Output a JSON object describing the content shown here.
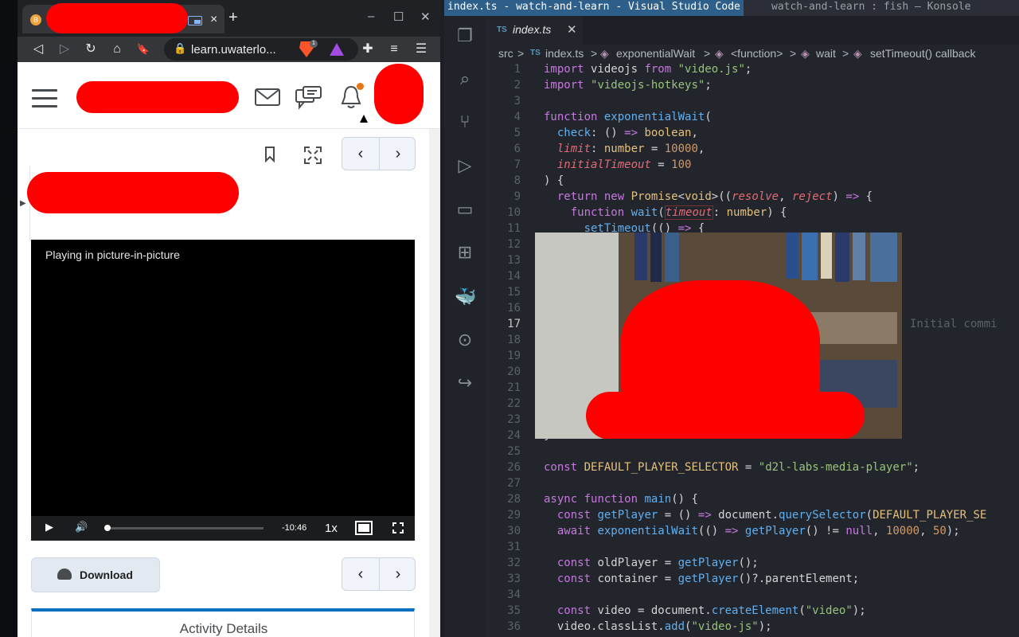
{
  "browser": {
    "tab_close": "×",
    "new_tab": "+",
    "win_min": "–",
    "win_max": "☐",
    "win_close": "✕",
    "url": "learn.uwaterlo...",
    "brave_badge": "1",
    "nav": {
      "back": "◁",
      "forward": "▷",
      "reload": "↻",
      "home": "⌂",
      "bookmark": "🔖"
    }
  },
  "page": {
    "pager_prev": "‹",
    "pager_next": "›",
    "video": {
      "pip_text": "Playing in picture-in-picture",
      "time_remaining": "-10:46",
      "playback_rate": "1x",
      "progress": 0.01
    },
    "download_label": "Download",
    "activity_details": "Activity Details"
  },
  "vscode": {
    "title": "index.ts - watch-and-learn - Visual Studio Code",
    "other_window": "watch-and-learn : fish — Konsole",
    "tab": {
      "badge": "TS",
      "name": "index.ts",
      "close": "✕"
    },
    "breadcrumbs": [
      "src",
      ">",
      "TS",
      "index.ts",
      ">",
      "exponentialWait",
      ">",
      "<function>",
      ">",
      "wait",
      ">",
      "setTimeout() callback"
    ],
    "blame": "Initial commi",
    "active_line": 17
  }
}
